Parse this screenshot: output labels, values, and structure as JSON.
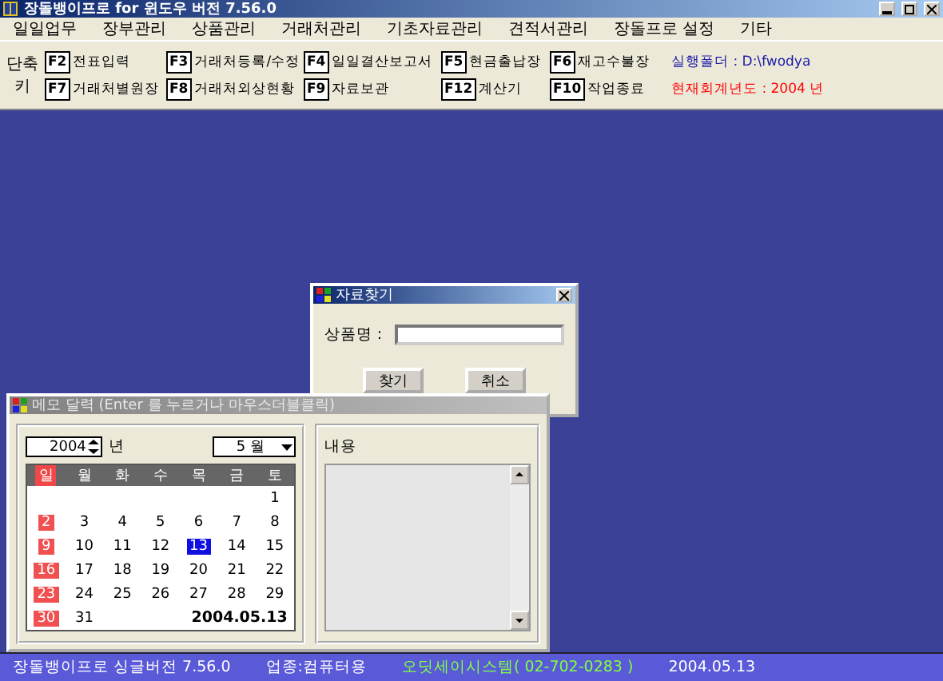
{
  "window": {
    "title": "장돌뱅이프로 for 윈도우 버전 7.56.0"
  },
  "menu": [
    "일일업무",
    "장부관리",
    "상품관리",
    "거래처관리",
    "기초자료관리",
    "견적서관리",
    "장돌프로 설정",
    "기타"
  ],
  "shortcut_label": "단축키",
  "shortcut_rows": [
    [
      {
        "key": "F2",
        "label": "전표입력"
      },
      {
        "key": "F3",
        "label": "거래처등록/수정"
      },
      {
        "key": "F4",
        "label": "일일결산보고서"
      },
      {
        "key": "F5",
        "label": "현금출납장"
      },
      {
        "key": "F6",
        "label": "재고수불장"
      }
    ],
    [
      {
        "key": "F7",
        "label": "거래처별원장"
      },
      {
        "key": "F8",
        "label": "거래처외상현황"
      },
      {
        "key": "F9",
        "label": "자료보관"
      },
      {
        "key": "F12",
        "label": "계산기"
      },
      {
        "key": "F10",
        "label": "작업종료"
      }
    ]
  ],
  "info": [
    {
      "label": "실행폴더 : D:\\fwodya",
      "color": "#1a1aa8"
    },
    {
      "label": "현재회계년도 : 2004  년",
      "color": "#ff0000"
    }
  ],
  "search_dialog": {
    "title": "자료찾기",
    "field_label": "상품명 :",
    "buttons": [
      "찾기",
      "취소"
    ]
  },
  "calendar_window": {
    "title": "메모 달력 (Enter 를 누르거나 마우스더블클릭)",
    "year": "2004",
    "year_suffix": "년",
    "month": "5 월",
    "weekdays": [
      "일",
      "월",
      "화",
      "수",
      "목",
      "금",
      "토"
    ],
    "weeks": [
      {
        "kind": "first",
        "days": [
          {
            "day": "1",
            "selected": false
          }
        ]
      },
      {
        "kind": "week",
        "days": [
          {
            "day": "2",
            "selected": false
          },
          {
            "day": "3",
            "selected": false
          },
          {
            "day": "4",
            "selected": false
          },
          {
            "day": "5",
            "selected": false
          },
          {
            "day": "6",
            "selected": false
          },
          {
            "day": "7",
            "selected": false
          },
          {
            "day": "8",
            "selected": false
          }
        ]
      },
      {
        "kind": "week",
        "days": [
          {
            "day": "9",
            "selected": false
          },
          {
            "day": "10",
            "selected": false
          },
          {
            "day": "11",
            "selected": false
          },
          {
            "day": "12",
            "selected": false
          },
          {
            "day": "13",
            "selected": true
          },
          {
            "day": "14",
            "selected": false
          },
          {
            "day": "15",
            "selected": false
          }
        ]
      },
      {
        "kind": "week",
        "days": [
          {
            "day": "16",
            "selected": false
          },
          {
            "day": "17",
            "selected": false
          },
          {
            "day": "18",
            "selected": false
          },
          {
            "day": "19",
            "selected": false
          },
          {
            "day": "20",
            "selected": false
          },
          {
            "day": "21",
            "selected": false
          },
          {
            "day": "22",
            "selected": false
          }
        ]
      },
      {
        "kind": "week",
        "days": [
          {
            "day": "23",
            "selected": false
          },
          {
            "day": "24",
            "selected": false
          },
          {
            "day": "25",
            "selected": false
          },
          {
            "day": "26",
            "selected": false
          },
          {
            "day": "27",
            "selected": false
          },
          {
            "day": "28",
            "selected": false
          },
          {
            "day": "29",
            "selected": false
          }
        ]
      },
      {
        "kind": "week",
        "days": [
          {
            "day": "30",
            "selected": false
          },
          {
            "day": "31",
            "selected": false
          }
        ]
      }
    ],
    "date": "2004.05.13",
    "memo_label": "내용"
  },
  "status_bar": [
    {
      "text": "장돌뱅이프로 싱글버전 7.56.0",
      "kind": "normal"
    },
    {
      "text": "업종:컴퓨터용",
      "kind": "normal"
    },
    {
      "text": "오딧세이시스템( 02-702-0283 )",
      "kind": "highlight"
    },
    {
      "text": "2004.05.13",
      "kind": "normal"
    }
  ]
}
